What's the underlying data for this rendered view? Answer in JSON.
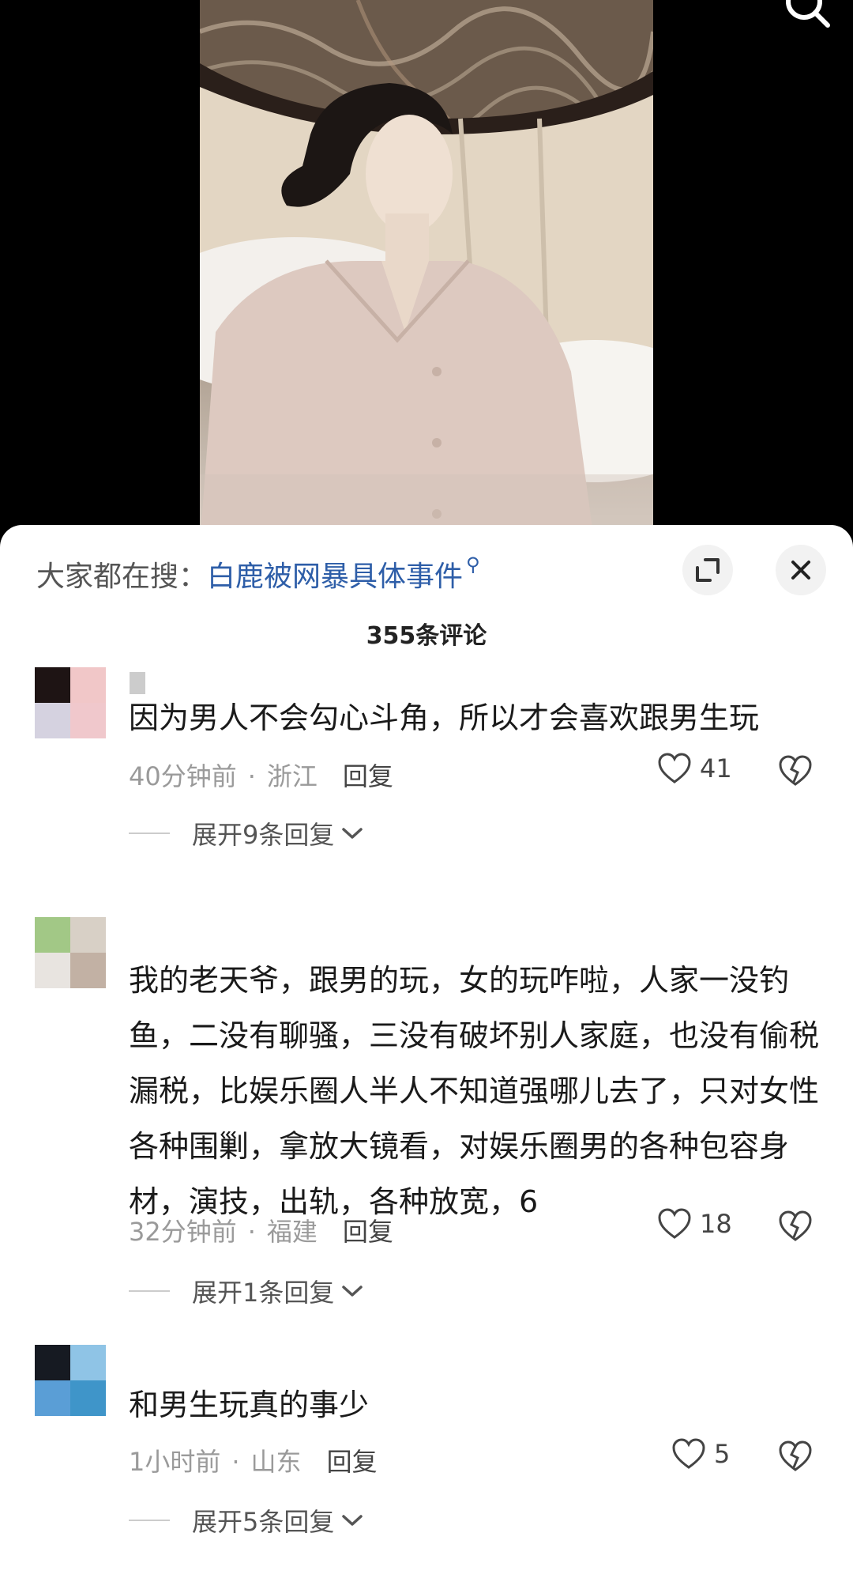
{
  "hot_search": {
    "prefix": "大家都在搜：",
    "keyword": "白鹿被网暴具体事件"
  },
  "comment_count": "355条评论",
  "comments": [
    {
      "username": "",
      "text": "因为男人不会勾心斗角，所以才会喜欢跟男生玩",
      "time": "40分钟前",
      "location": "浙江",
      "reply_label": "回复",
      "likes": "41",
      "expand_label": "展开9条回复",
      "avatar_colors": [
        "#1e1414",
        "#f1c7c8",
        "#d5d2e0",
        "#f0c8cc"
      ]
    },
    {
      "username": "",
      "text": "我的老天爷，跟男的玩，女的玩咋啦，人家一没钓鱼，二没有聊骚，三没有破坏别人家庭，也没有偷税漏税，比娱乐圈人半人不知道强哪儿去了，只对女性各种围剿，拿放大镜看，对娱乐圈男的各种包容身材，演技，出轨，各种放宽，6",
      "time": "32分钟前",
      "location": "福建",
      "reply_label": "回复",
      "likes": "18",
      "expand_label": "展开1条回复",
      "avatar_colors": [
        "#a2c886",
        "#d8d0c6",
        "#e8e4e0",
        "#c2b1a4"
      ]
    },
    {
      "username": "",
      "text": "和男生玩真的事少",
      "time": "1小时前",
      "location": "山东",
      "reply_label": "回复",
      "likes": "5",
      "expand_label": "展开5条回复",
      "avatar_colors": [
        "#161a22",
        "#8fc4e6",
        "#5a9ed6",
        "#3f95c9"
      ]
    }
  ]
}
